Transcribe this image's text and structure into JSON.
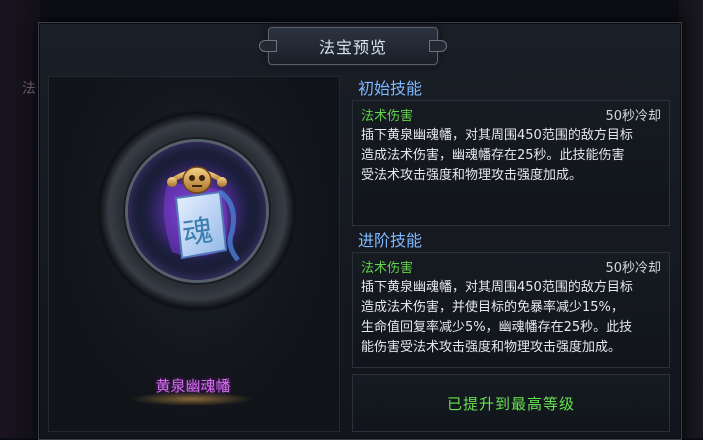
{
  "window": {
    "title": "法宝预览"
  },
  "background": {
    "side_glyph": "法"
  },
  "item": {
    "name": "黄泉幽魂幡",
    "icon": "soul-banner-icon",
    "icon_glyph": "魂"
  },
  "initial_skill": {
    "header": "初始技能",
    "type": "法术伤害",
    "cooldown": "50秒冷却",
    "lines": [
      "插下黄泉幽魂幡，对其周围450范围的敌方目标",
      "造成法术伤害，幽魂幡存在25秒。此技能伤害",
      "受法术攻击强度和物理攻击强度加成。"
    ]
  },
  "advanced_skill": {
    "header": "进阶技能",
    "type": "法术伤害",
    "cooldown": "50秒冷却",
    "lines": [
      "插下黄泉幽魂幡，对其周围450范围的敌方目标",
      "造成法术伤害，并使目标的免暴率减少15%，",
      "生命值回复率减少5%，幽魂幡存在25秒。此技",
      "能伤害受法术攻击强度和物理攻击强度加成。"
    ]
  },
  "status": {
    "max_level": "已提升到最高等级"
  },
  "colors": {
    "header_blue": "#7db9ff",
    "skill_type_green": "#63d24b",
    "max_level_green": "#66e24f",
    "item_name_purple": "#d56cf0"
  }
}
